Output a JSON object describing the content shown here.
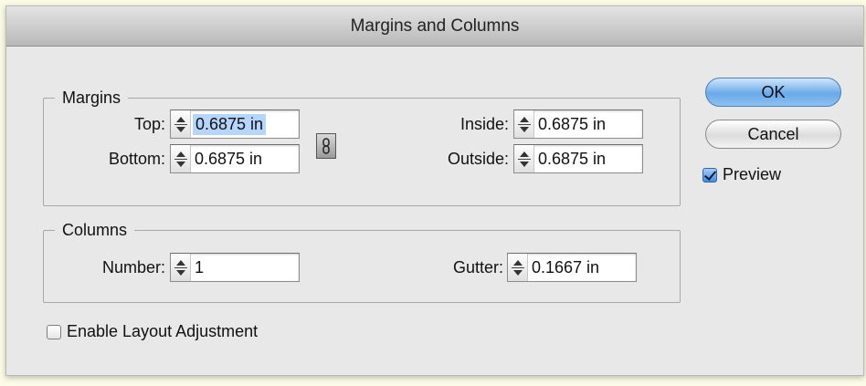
{
  "dialog": {
    "title": "Margins and Columns"
  },
  "margins": {
    "legend": "Margins",
    "top": {
      "label": "Top:",
      "value": "0.6875 in"
    },
    "bottom": {
      "label": "Bottom:",
      "value": "0.6875 in"
    },
    "inside": {
      "label": "Inside:",
      "value": "0.6875 in"
    },
    "outside": {
      "label": "Outside:",
      "value": "0.6875 in"
    },
    "link_icon": "chain-link-icon"
  },
  "columns": {
    "legend": "Columns",
    "number": {
      "label": "Number:",
      "value": "1"
    },
    "gutter": {
      "label": "Gutter:",
      "value": "0.1667 in"
    }
  },
  "buttons": {
    "ok": "OK",
    "cancel": "Cancel"
  },
  "preview": {
    "label": "Preview",
    "checked": true
  },
  "layout_adjustment": {
    "label": "Enable Layout Adjustment",
    "checked": false
  },
  "colors": {
    "accent": "#6aa9ea",
    "selection": "#b5d5fc",
    "background": "#e8e8e8"
  }
}
